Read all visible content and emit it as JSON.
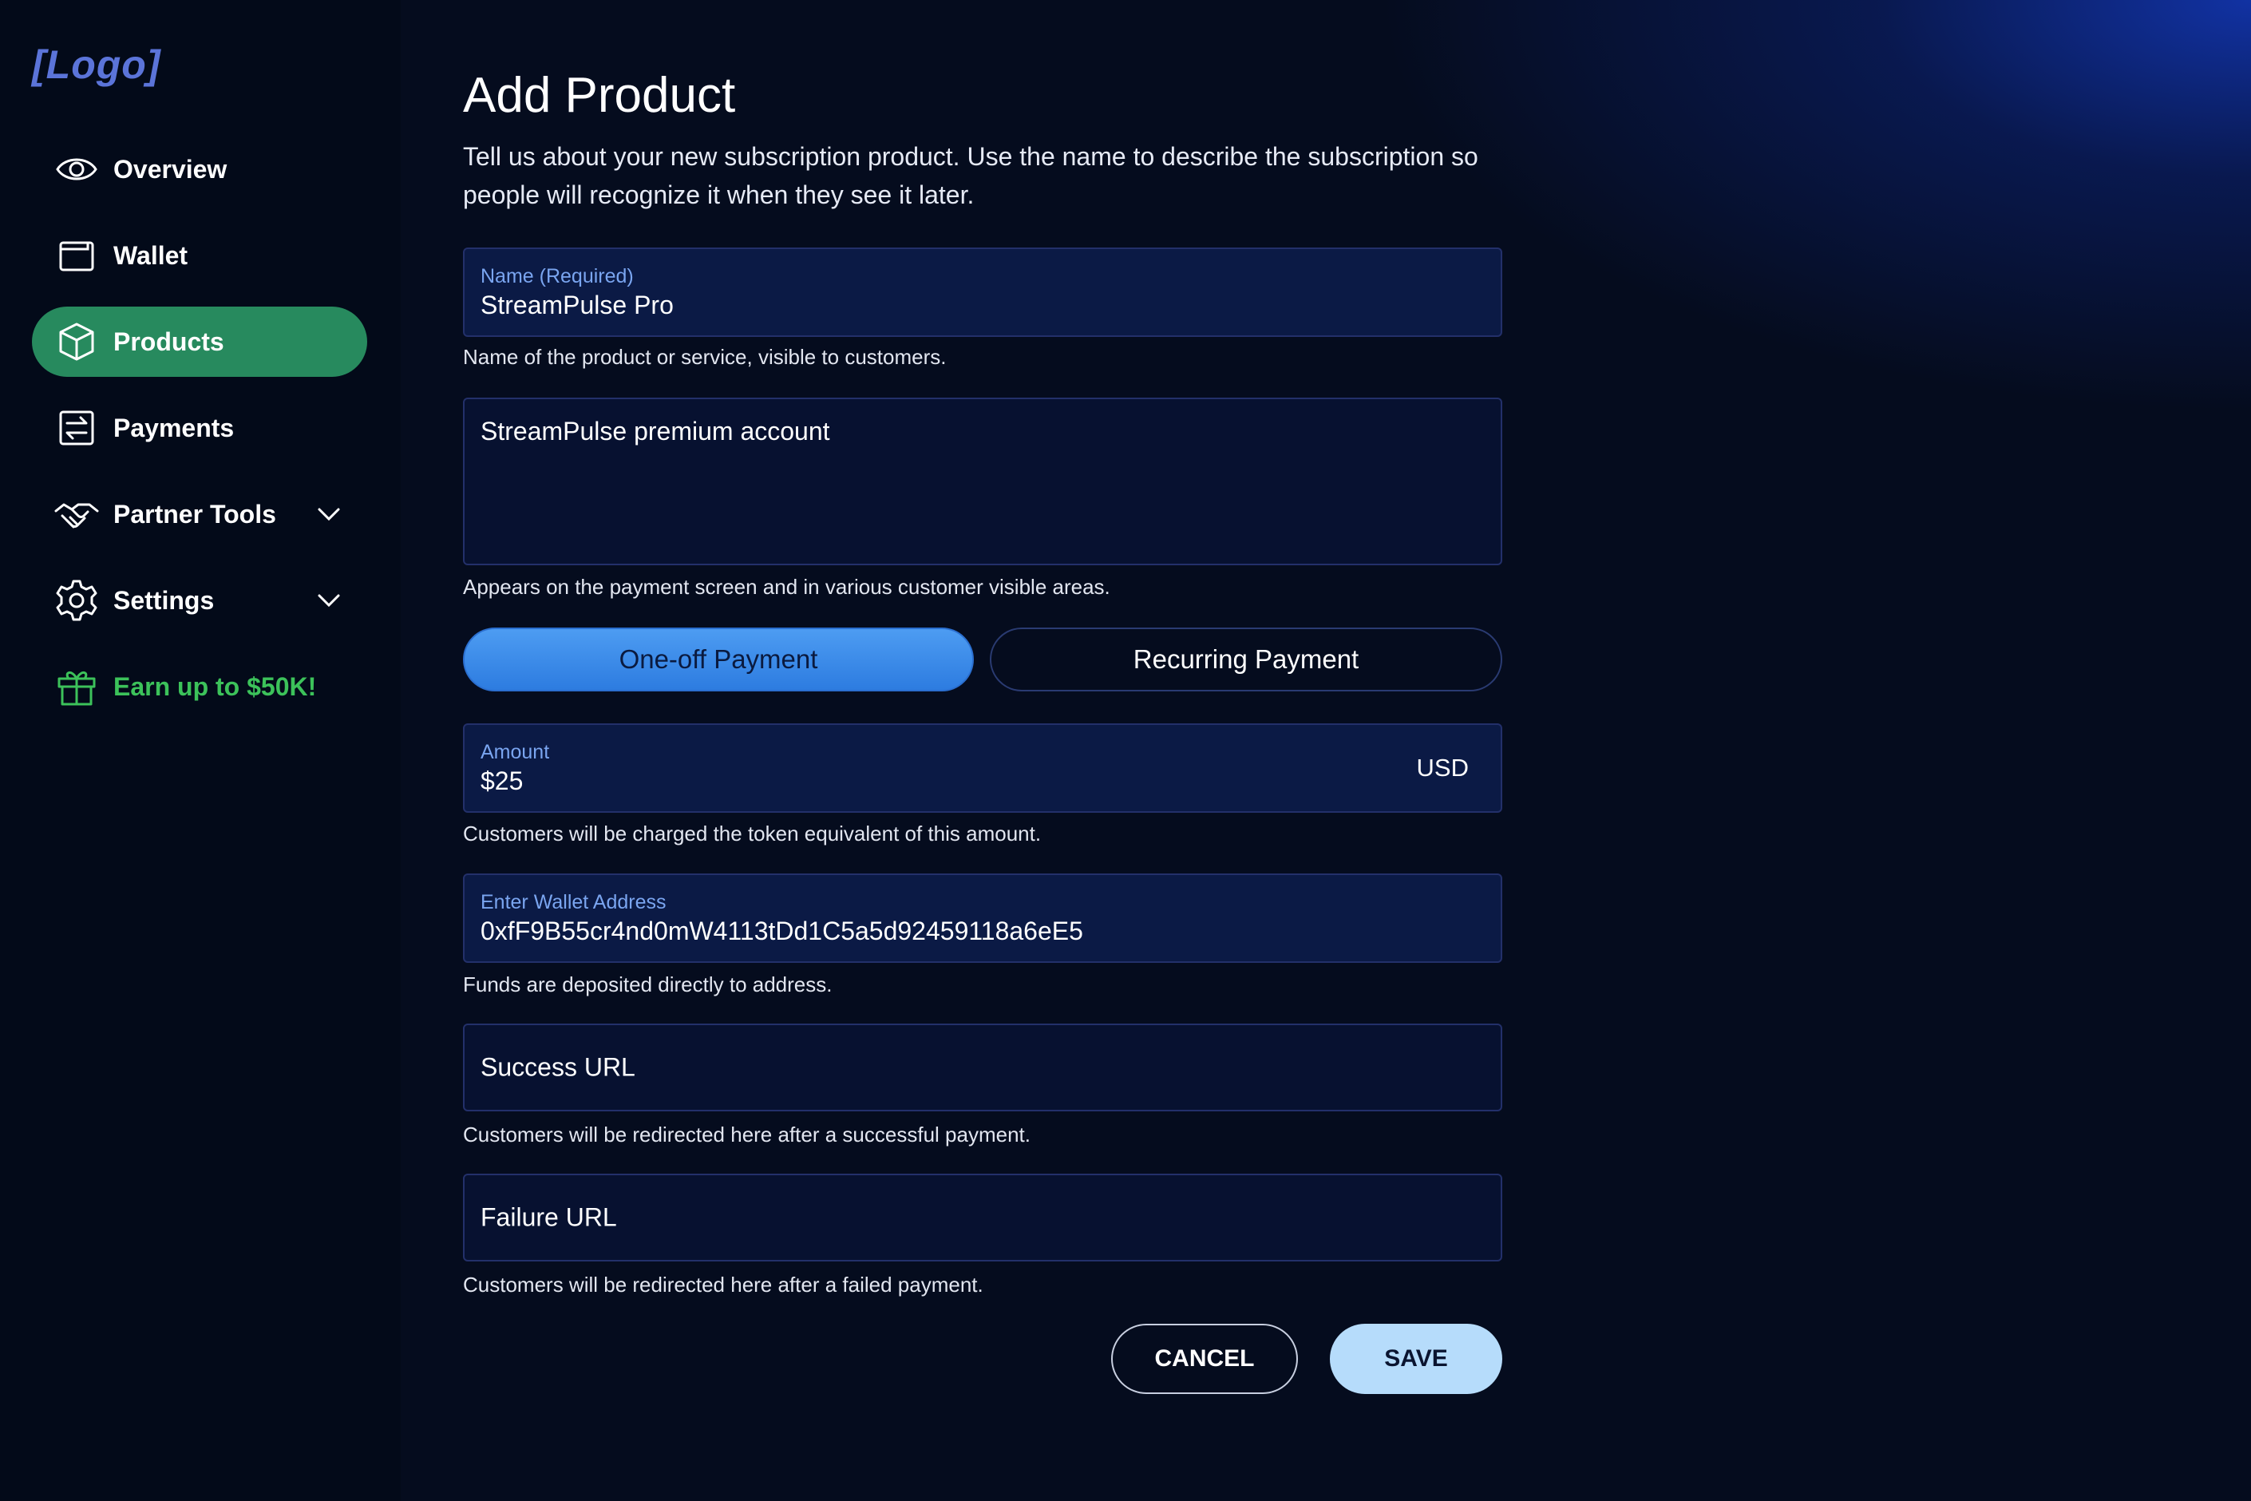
{
  "sidebar": {
    "logo": "[Logo]",
    "items": [
      {
        "label": "Overview",
        "icon": "eye-icon"
      },
      {
        "label": "Wallet",
        "icon": "wallet-icon"
      },
      {
        "label": "Products",
        "icon": "box-icon",
        "active": true
      },
      {
        "label": "Payments",
        "icon": "transfer-icon"
      },
      {
        "label": "Partner Tools",
        "icon": "handshake-icon",
        "expandable": true
      },
      {
        "label": "Settings",
        "icon": "gear-icon",
        "expandable": true
      }
    ],
    "promo": {
      "label": "Earn up to $50K!",
      "icon": "gift-icon"
    }
  },
  "colors": {
    "background": "#050c1e",
    "sidebar": "#030a19",
    "active_nav": "#278a5e",
    "promo_text": "#3cc25a",
    "accent_blue": "#2d7ce0",
    "field_label": "#7aa5f0",
    "save_button": "#b6dcfb"
  },
  "main": {
    "title": "Add Product",
    "description": "Tell us about your new subscription product. Use the name to describe the subscription so people will recognize it when they see it later.",
    "name_field": {
      "label": "Name (Required)",
      "value": "StreamPulse Pro",
      "helper": "Name of the product or service, visible to customers."
    },
    "description_field": {
      "value": "StreamPulse premium account",
      "helper": "Appears on the payment screen and in various customer visible areas."
    },
    "payment_type": {
      "options": [
        "One-off Payment",
        "Recurring Payment"
      ],
      "selected": "One-off Payment"
    },
    "amount_field": {
      "label": "Amount",
      "value": "$25",
      "currency": "USD",
      "helper": "Customers will be charged the token equivalent of this amount."
    },
    "wallet_field": {
      "label": "Enter Wallet Address",
      "value": "0xfF9B55cr4nd0mW4113tDd1C5a5d92459118a6eE5",
      "helper": "Funds are deposited directly to address."
    },
    "success_url_field": {
      "placeholder": "Success URL",
      "helper": "Customers will be redirected here after a successful payment."
    },
    "failure_url_field": {
      "placeholder": "Failure URL",
      "helper": "Customers will be redirected here after a failed payment."
    },
    "actions": {
      "cancel_label": "CANCEL",
      "save_label": "SAVE"
    }
  }
}
